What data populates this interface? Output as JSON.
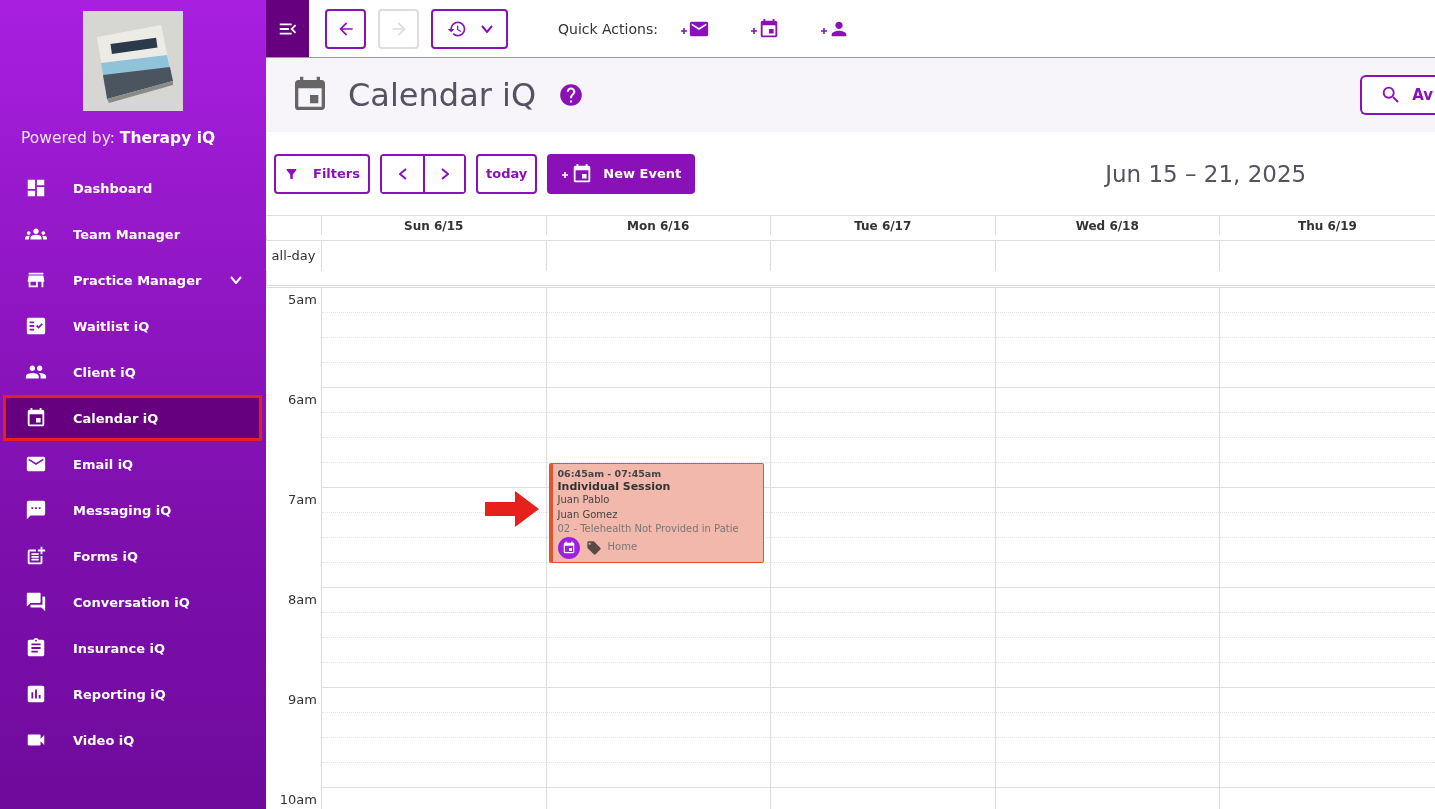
{
  "brand": {
    "powered_by": "Powered by: **Therapy iQ**"
  },
  "sidebar": {
    "items": [
      {
        "label": "Dashboard",
        "kind": "link",
        "selected": false
      },
      {
        "label": "Team Manager",
        "kind": "link",
        "selected": false
      },
      {
        "label": "Practice Manager",
        "kind": "group",
        "selected": false
      },
      {
        "label": "Waitlist iQ",
        "kind": "link",
        "selected": false
      },
      {
        "label": "Client iQ",
        "kind": "link",
        "selected": false
      },
      {
        "label": "Calendar iQ",
        "kind": "link",
        "selected": true
      },
      {
        "label": "Email iQ",
        "kind": "link",
        "selected": false
      },
      {
        "label": "Messaging iQ",
        "kind": "link",
        "selected": false
      },
      {
        "label": "Forms iQ",
        "kind": "link",
        "selected": false
      },
      {
        "label": "Conversation iQ",
        "kind": "link",
        "selected": false
      },
      {
        "label": "Insurance iQ",
        "kind": "link",
        "selected": false
      },
      {
        "label": "Reporting iQ",
        "kind": "link",
        "selected": false
      },
      {
        "label": "Video iQ",
        "kind": "link",
        "selected": false
      }
    ]
  },
  "topbar": {
    "back_disabled": false,
    "forward_disabled": true,
    "quick_actions_label": "Quick Actions:"
  },
  "page": {
    "title": "Calendar iQ",
    "search_button": "Av"
  },
  "toolbar": {
    "filters": "Filters",
    "today": "today",
    "new_event": "New Event",
    "range": "Jun 15 – 21, 2025"
  },
  "calendar": {
    "days": [
      {
        "label": "Sun 6/15"
      },
      {
        "label": "Mon 6/16",
        "events": [
          {
            "time": "06:45am - 07:45am",
            "title": "Individual Session",
            "lines": [
              "Juan Pablo",
              "Juan Gomez",
              "02 - Telehealth Not Provided in Patie"
            ],
            "footer": "Home",
            "color": "#f2b8ac"
          }
        ]
      },
      {
        "label": "Tue 6/17"
      },
      {
        "label": "Wed 6/18"
      },
      {
        "label": "Thu 6/19"
      }
    ],
    "all_day_label": "all-day",
    "hours": [
      "5am",
      "6am",
      "7am",
      "8am",
      "9am",
      "10am"
    ]
  }
}
